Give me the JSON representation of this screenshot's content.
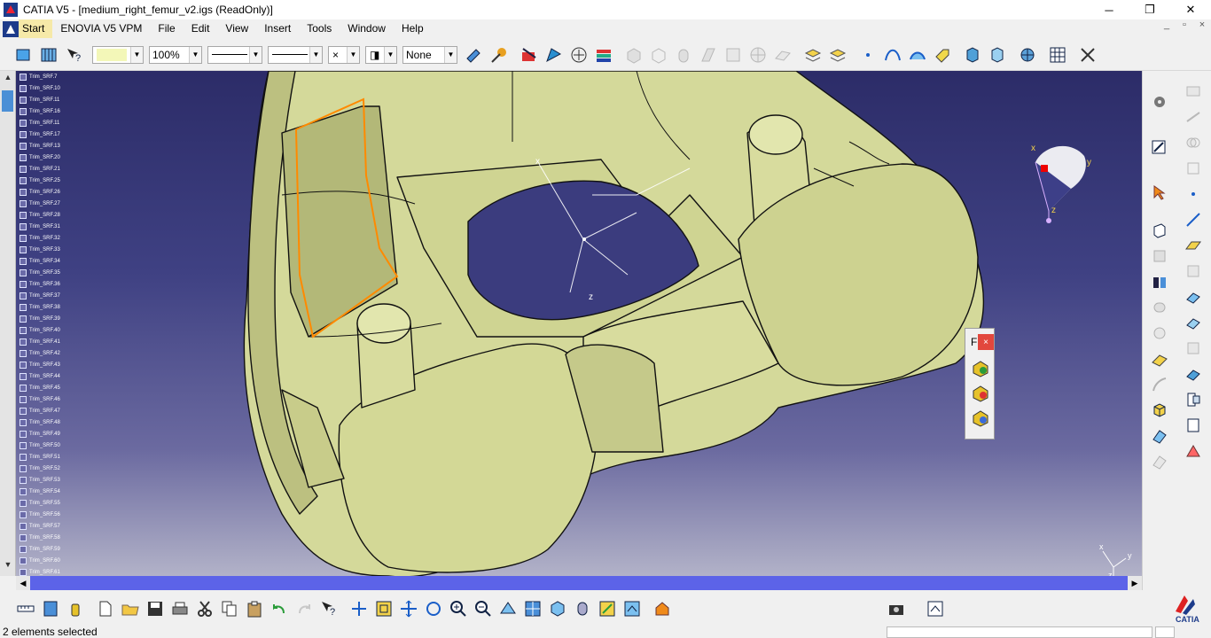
{
  "window": {
    "title": "CATIA V5 - [medium_right_femur_v2.igs (ReadOnly)]",
    "controls": [
      "─",
      "❐",
      "✕"
    ]
  },
  "menubar": {
    "items": [
      "Start",
      "ENOVIA V5 VPM",
      "File",
      "Edit",
      "View",
      "Insert",
      "Tools",
      "Window",
      "Help"
    ],
    "mdi_controls": [
      "_",
      "▫",
      "×"
    ]
  },
  "toolbar_top": {
    "zoom": "100%",
    "layer": "None",
    "color_swatch": "#f3f7b8"
  },
  "tree": {
    "items": [
      "Trim_SRF.7",
      "Trim_SRF.10",
      "Trim_SRF.11",
      "Trim_SRF.16",
      "Trim_SRF.11",
      "Trim_SRF.17",
      "Trim_SRF.13",
      "Trim_SRF.20",
      "Trim_SRF.21",
      "Trim_SRF.25",
      "Trim_SRF.26",
      "Trim_SRF.27",
      "Trim_SRF.28",
      "Trim_SRF.31",
      "Trim_SRF.32",
      "Trim_SRF.33",
      "Trim_SRF.34",
      "Trim_SRF.35",
      "Trim_SRF.36",
      "Trim_SRF.37",
      "Trim_SRF.38",
      "Trim_SRF.39",
      "Trim_SRF.40",
      "Trim_SRF.41",
      "Trim_SRF.42",
      "Trim_SRF.43",
      "Trim_SRF.44",
      "Trim_SRF.45",
      "Trim_SRF.46",
      "Trim_SRF.47",
      "Trim_SRF.48",
      "Trim_SRF.49",
      "Trim_SRF.50",
      "Trim_SRF.51",
      "Trim_SRF.52",
      "Trim_SRF.53",
      "Trim_SRF.54",
      "Trim_SRF.55",
      "Trim_SRF.56",
      "Trim_SRF.57",
      "Trim_SRF.58",
      "Trim_SRF.59",
      "Trim_SRF.60",
      "Trim_SRF.61"
    ]
  },
  "viewport": {
    "compass_labels": {
      "x": "x",
      "y": "y",
      "z": "z"
    },
    "axis_labels": {
      "x": "x",
      "y": "y",
      "z": "z"
    }
  },
  "floatpanel": {
    "title": "F",
    "close": "×"
  },
  "statusbar": {
    "text": "2 elements selected"
  },
  "colors": {
    "part": "#d6dc9a",
    "part_shade": "#b7bc78",
    "selection": "#ff8a00",
    "scroll_active": "#5c63e8"
  }
}
